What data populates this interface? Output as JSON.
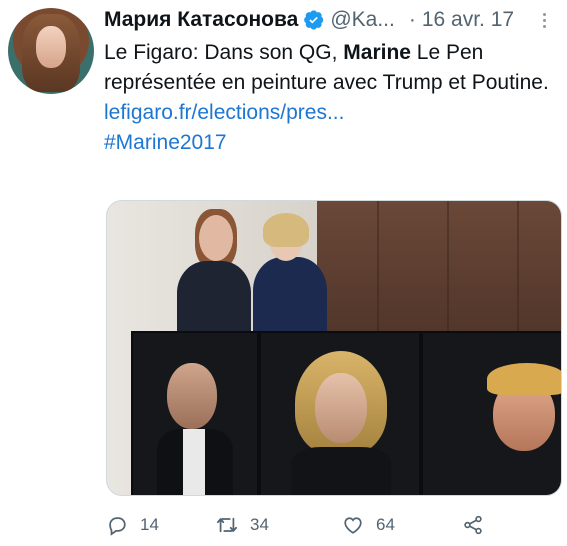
{
  "tweet": {
    "author": {
      "name": "Мария Катасонова",
      "handle": "@Ka...",
      "verified": true
    },
    "separator": "·",
    "date": "16 avr. 17",
    "text": {
      "part1": "Le Figaro: Dans son QG, ",
      "bold": "Marine",
      "part2": " Le Pen représentée en peinture avec Trump et Poutine."
    },
    "link": "lefigaro.fr/elections/pres...",
    "hashtag": "#Marine2017",
    "actions": {
      "replies": "14",
      "retweets": "34",
      "likes": "64"
    },
    "colors": {
      "link": "#1d77d2",
      "verified": "#1d9bf0",
      "muted": "#536471"
    }
  }
}
